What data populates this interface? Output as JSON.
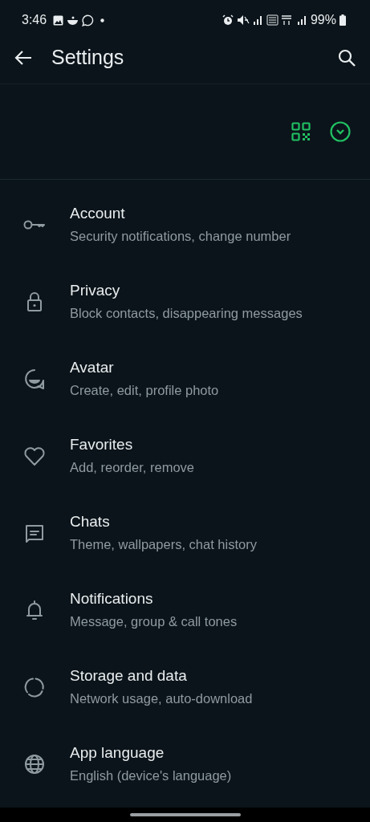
{
  "status_bar": {
    "time": "3:46",
    "battery": "99%"
  },
  "app_bar": {
    "title": "Settings"
  },
  "settings": [
    {
      "kind": "key",
      "title": "Account",
      "subtitle": "Security notifications, change number"
    },
    {
      "kind": "lock",
      "title": "Privacy",
      "subtitle": "Block contacts, disappearing messages"
    },
    {
      "kind": "avatar",
      "title": "Avatar",
      "subtitle": "Create, edit, profile photo"
    },
    {
      "kind": "heart",
      "title": "Favorites",
      "subtitle": "Add, reorder, remove"
    },
    {
      "kind": "chat",
      "title": "Chats",
      "subtitle": "Theme, wallpapers, chat history"
    },
    {
      "kind": "bell",
      "title": "Notifications",
      "subtitle": "Message, group & call tones"
    },
    {
      "kind": "storage",
      "title": "Storage and data",
      "subtitle": "Network usage, auto-download"
    },
    {
      "kind": "globe",
      "title": "App language",
      "subtitle": "English (device's language)"
    }
  ]
}
